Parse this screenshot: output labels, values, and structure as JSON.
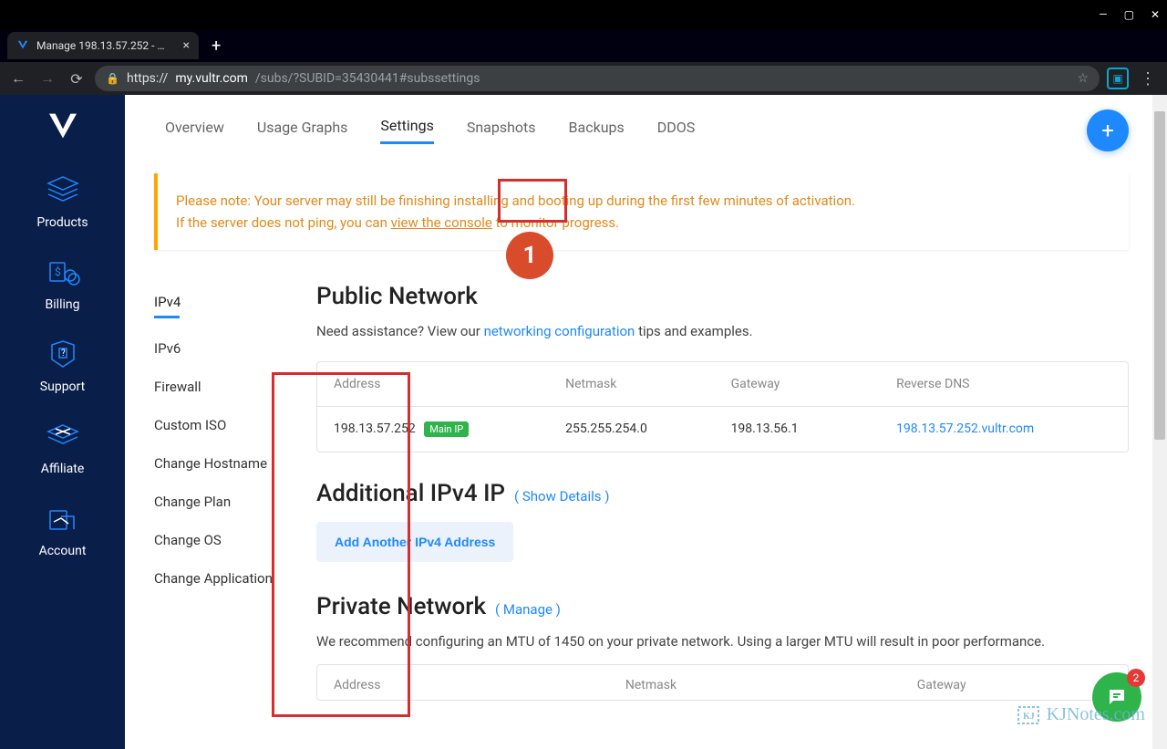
{
  "window": {
    "title": "Manage 198.13.57.252 - Vultr..."
  },
  "browser": {
    "url_host": "my.vultr.com",
    "url_path": "/subs/?SUBID=35430441#subssettings",
    "url_scheme": "https://"
  },
  "sidebar": {
    "items": [
      {
        "label": "Products"
      },
      {
        "label": "Billing"
      },
      {
        "label": "Support"
      },
      {
        "label": "Affiliate"
      },
      {
        "label": "Account"
      }
    ]
  },
  "tabs": {
    "items": [
      {
        "label": "Overview"
      },
      {
        "label": "Usage Graphs"
      },
      {
        "label": "Settings",
        "active": true
      },
      {
        "label": "Snapshots"
      },
      {
        "label": "Backups"
      },
      {
        "label": "DDOS"
      }
    ]
  },
  "annotations": {
    "circle1": "1"
  },
  "notice": {
    "line1_a": "Please note: Your server may still be finishing installing and booting up during the first few minutes of activation.",
    "line2_a": "If the server does not ping, you can ",
    "line2_link": "view the console",
    "line2_b": " to monitor progress."
  },
  "sub_nav": {
    "items": [
      {
        "label": "IPv4",
        "active": true
      },
      {
        "label": "IPv6"
      },
      {
        "label": "Firewall"
      },
      {
        "label": "Custom ISO"
      },
      {
        "label": "Change Hostname"
      },
      {
        "label": "Change Plan"
      },
      {
        "label": "Change OS"
      },
      {
        "label": "Change Application"
      }
    ]
  },
  "public_net": {
    "title": "Public Network",
    "assist_a": "Need assistance? View our ",
    "assist_link": "networking configuration",
    "assist_b": " tips and examples.",
    "headers": {
      "address": "Address",
      "netmask": "Netmask",
      "gateway": "Gateway",
      "rdns": "Reverse DNS"
    },
    "row": {
      "address": "198.13.57.252",
      "badge": "Main IP",
      "netmask": "255.255.254.0",
      "gateway": "198.13.56.1",
      "rdns": "198.13.57.252.vultr.com"
    }
  },
  "additional": {
    "title": "Additional IPv4 IP",
    "show_details": "( Show Details )",
    "add_button": "Add Another IPv4 Address"
  },
  "private_net": {
    "title": "Private Network",
    "manage": "( Manage )",
    "mtu": "We recommend configuring an MTU of 1450 on your private network. Using a larger MTU will result in poor performance.",
    "headers": {
      "address": "Address",
      "netmask": "Netmask",
      "gateway": "Gateway"
    }
  },
  "chat": {
    "badge": "2"
  },
  "watermark": "KJNotes.com"
}
